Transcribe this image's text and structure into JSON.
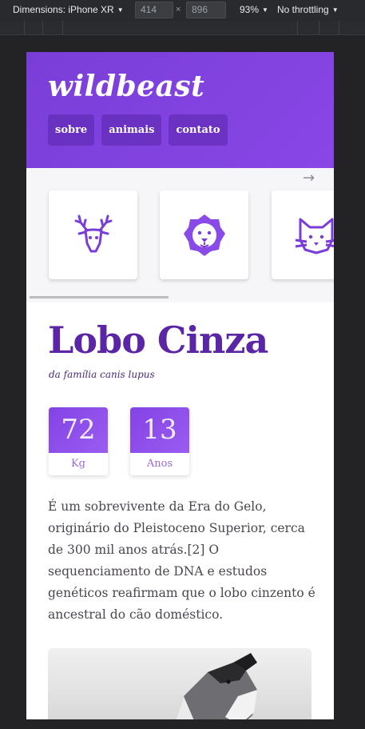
{
  "devtools": {
    "dimensions_label": "Dimensions: iPhone XR",
    "width_value": "414",
    "height_value": "896",
    "times": "×",
    "zoom": "93%",
    "throttling": "No throttling"
  },
  "site": {
    "logo": "wildbeast",
    "nav": [
      "sobre",
      "animais",
      "contato"
    ],
    "next_arrow": "→",
    "carousel_icons": [
      "deer-icon",
      "lion-icon",
      "cat-icon"
    ],
    "title": "Lobo Cinza",
    "subtitle": "da família canis lupus",
    "stats": [
      {
        "value": "72",
        "unit": "Kg"
      },
      {
        "value": "13",
        "unit": "Anos"
      }
    ],
    "paragraph": "É um sobrevivente da Era do Gelo, originário do Pleistoceno Superior, cerca de 300 mil anos atrás.[2] O sequenciamento de DNA e estudos genéticos reafirmam que o lobo cinzento é ancestral do cão doméstico.",
    "photo_icon": "howling-wolf-photo"
  },
  "colors": {
    "brand_purple": "#7a3ed8",
    "title_purple": "#5a26a6",
    "stat_purple": "#8443e6"
  }
}
